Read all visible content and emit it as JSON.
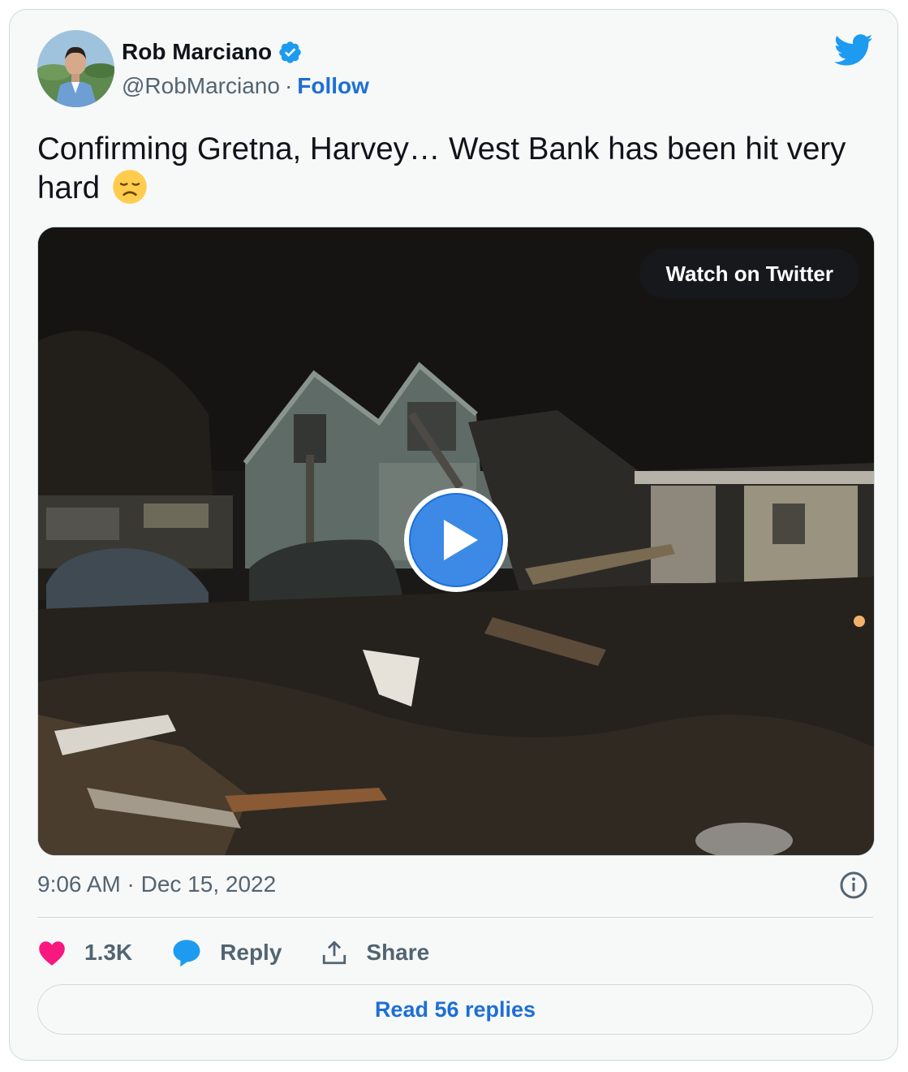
{
  "author": {
    "name": "Rob Marciano",
    "handle": "@RobMarciano",
    "separator": "·",
    "follow_label": "Follow",
    "verified": true
  },
  "tweet": {
    "text": "Confirming Gretna, Harvey… West Bank has been hit very hard",
    "emoji": "disappointed-face"
  },
  "media": {
    "watch_label": "Watch on Twitter",
    "type": "video"
  },
  "meta": {
    "timestamp": "9:06 AM · Dec 15, 2022"
  },
  "actions": {
    "like_count": "1.3K",
    "reply_label": "Reply",
    "share_label": "Share",
    "read_replies_label": "Read 56 replies"
  },
  "colors": {
    "accent": "#1d9bf0",
    "link": "#1d6fd6",
    "heart": "#f91880",
    "muted": "#536471",
    "border": "#cfd9de"
  }
}
